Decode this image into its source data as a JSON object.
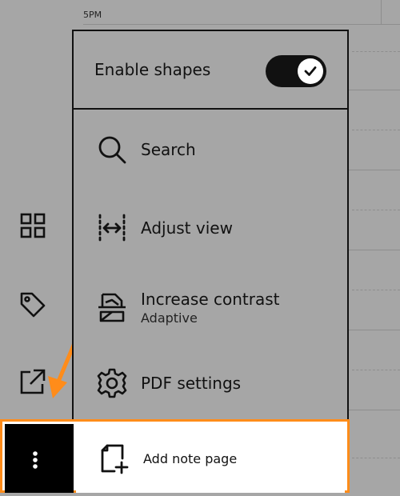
{
  "timeline": {
    "time_label": "5PM"
  },
  "sidebar": {
    "icons": [
      "grid-icon",
      "tag-icon",
      "share-icon",
      "more-icon"
    ]
  },
  "menu": {
    "enable_shapes": {
      "label": "Enable shapes",
      "enabled": true
    },
    "items": [
      {
        "label": "Search",
        "icon": "search-icon"
      },
      {
        "label": "Adjust view",
        "icon": "adjust-view-icon"
      },
      {
        "label": "Increase contrast",
        "sublabel": "Adaptive",
        "icon": "contrast-icon"
      },
      {
        "label": "PDF settings",
        "icon": "gear-icon"
      }
    ],
    "highlighted_item": {
      "label": "Add note page",
      "icon": "add-page-icon"
    }
  },
  "colors": {
    "background": "#a6a6a6",
    "highlight_border": "#ff8c1a",
    "arrow": "#ff8c1a"
  }
}
